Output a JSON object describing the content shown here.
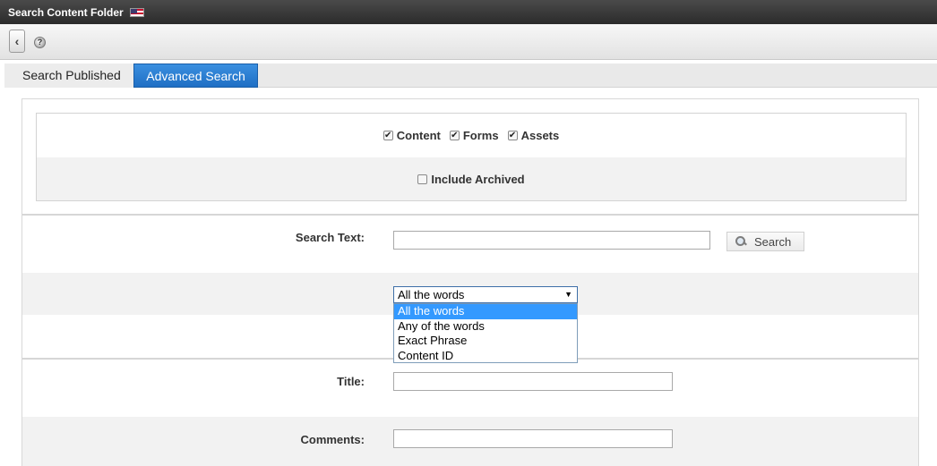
{
  "window": {
    "title": "Search Content Folder",
    "flag_icon": "us-flag-icon"
  },
  "toolbar": {
    "back_icon": "chevron-left-icon",
    "back_glyph": "‹",
    "help_icon": "help-icon",
    "help_glyph": "?"
  },
  "tabs": [
    {
      "label": "Search Published",
      "active": false
    },
    {
      "label": "Advanced Search",
      "active": true
    }
  ],
  "content_types": [
    {
      "label": "Content",
      "checked": true
    },
    {
      "label": "Forms",
      "checked": true
    },
    {
      "label": "Assets",
      "checked": true
    }
  ],
  "include_archived": {
    "label": "Include Archived",
    "checked": false
  },
  "search_text": {
    "label": "Search Text:",
    "value": "",
    "button_label": "Search"
  },
  "match_mode": {
    "selected": "All the words",
    "options": [
      "All the words",
      "Any of the words",
      "Exact Phrase",
      "Content ID"
    ],
    "highlighted_index": 0
  },
  "title_field": {
    "label": "Title:",
    "value": ""
  },
  "comments_field": {
    "label": "Comments:",
    "value": ""
  },
  "colors": {
    "accent": "#1f6fc4",
    "highlight": "#3399ff",
    "row_shade": "#f2f2f2",
    "titlebar": "#2b2b2b"
  },
  "check_glyph": "✔"
}
